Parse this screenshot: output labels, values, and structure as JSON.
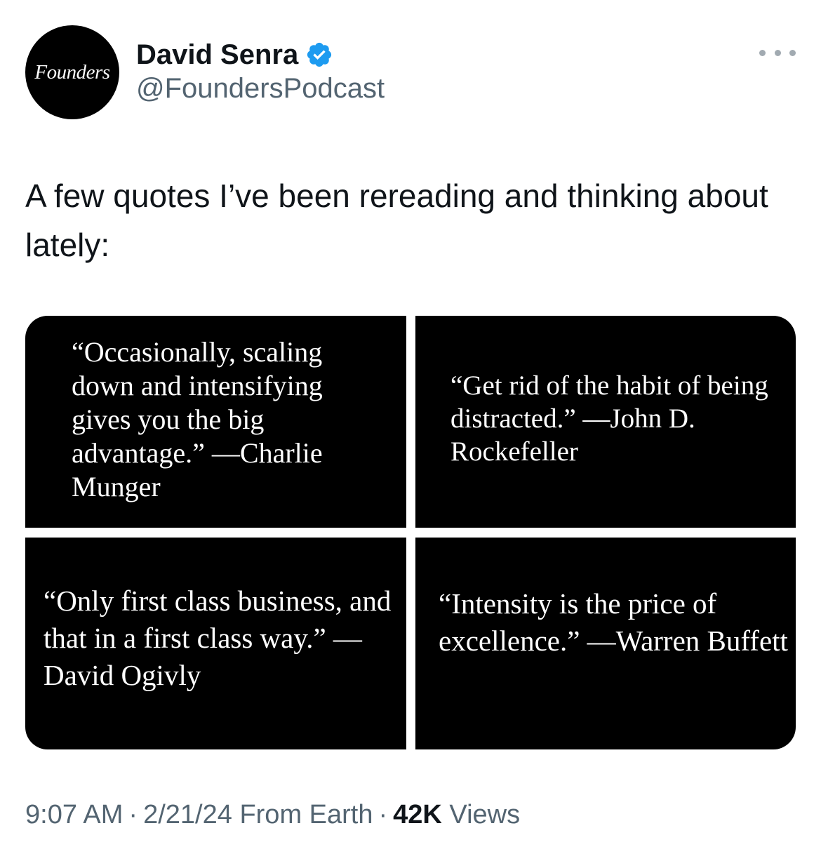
{
  "author": {
    "avatar_text": "Founders",
    "display_name": "David Senra",
    "handle": "@FoundersPodcast",
    "verified": true,
    "verified_color": "#1d9bf0"
  },
  "tweet": {
    "text": "A few quotes I’ve been rereading and thinking about lately:",
    "images": [
      {
        "quote": "“Occasionally, scaling down and intensifying gives you the big advantage.” —Charlie Munger"
      },
      {
        "quote": "“Get rid of the habit of being distracted.” —John D. Rockefeller"
      },
      {
        "quote": "“Only first class business, and that in a first class way.” —David Ogivly"
      },
      {
        "quote": "“Intensity is the price of excellence.” —Warren Buffett"
      }
    ]
  },
  "meta": {
    "time": "9:07 AM",
    "separator": "·",
    "date": "2/21/24",
    "source": "From Earth",
    "views_count": "42K",
    "views_label": "Views"
  },
  "icons": {
    "verified": "verified-badge-icon",
    "more": "more-options-icon"
  },
  "colors": {
    "text_primary": "#0f1419",
    "text_secondary": "#536471",
    "tile_background": "#000000"
  }
}
